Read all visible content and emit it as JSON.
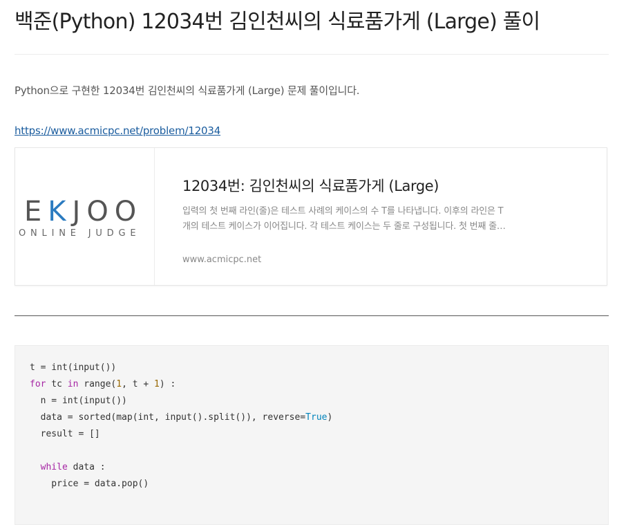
{
  "post": {
    "title": "백준(Python) 12034번 김인천씨의 식료품가게 (Large) 풀이",
    "intro": "Python으로 구현한 12034번 김인천씨의 식료품가게 (Large) 문제 풀이입니다.",
    "link_text": "https://www.acmicpc.net/problem/12034"
  },
  "link_card": {
    "logo": {
      "prefix": "E",
      "k": "K",
      "suffix": "JOO",
      "sub": "ONLINE JUDGE"
    },
    "title": "12034번: 김인천씨의 식료품가게 (Large)",
    "description": "입력의 첫 번째 라인(줄)은 테스트 사례의 케이스의 수 T를 나타냅니다. 이후의 라인은 T개의 테스트 케이스가 이어집니다. 각 테스트 케이스는 두 줄로 구성됩니다. 첫 번째 줄에는 상품의 수 N이 주어집니다.",
    "domain": "www.acmicpc.net"
  },
  "code": {
    "language": "python",
    "lines": [
      "t = int(input())",
      "for tc in range(1, t + 1) :",
      "  n = int(input())",
      "  data = sorted(map(int, input().split()), reverse=True)",
      "  result = []",
      "",
      "  while data :",
      "    price = data.pop()"
    ]
  },
  "colors": {
    "link": "#1a5c9e",
    "logo_accent": "#2b7bc0",
    "keyword": "#a626a4",
    "number": "#986801",
    "builtin_const": "#0184bc"
  }
}
